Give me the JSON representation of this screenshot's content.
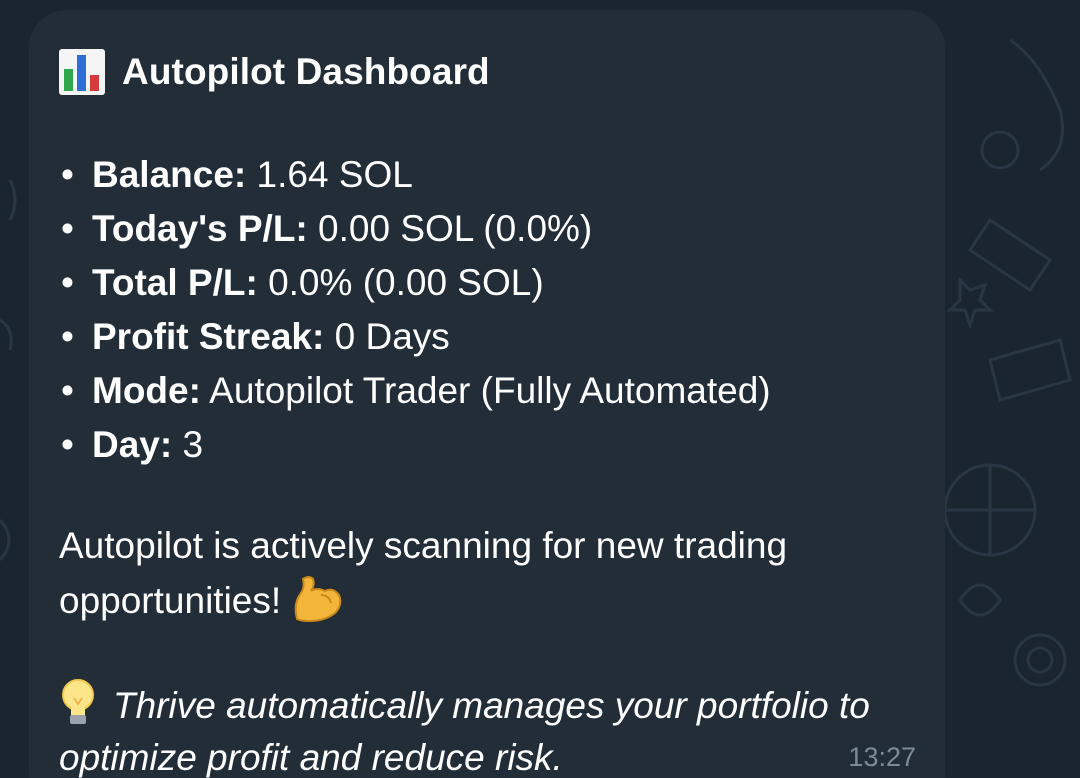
{
  "message": {
    "title": "Autopilot Dashboard",
    "title_icon": "bar-chart-icon",
    "stats": [
      {
        "label": "Balance:",
        "value": " 1.64 SOL"
      },
      {
        "label": "Today's P/L:",
        "value": " 0.00 SOL (0.0%)"
      },
      {
        "label": "Total P/L:",
        "value": " 0.0% (0.00 SOL)"
      },
      {
        "label": "Profit Streak:",
        "value": " 0 Days"
      },
      {
        "label": "Mode:",
        "value": " Autopilot Trader (Fully Automated)"
      },
      {
        "label": "Day:",
        "value": " 3"
      }
    ],
    "bullet": "•",
    "status_text": "Autopilot is actively scanning for new trading opportunities!",
    "status_emoji": "flexed-biceps-icon",
    "tip_icon": "light-bulb-icon",
    "tip_text": "Thrive automatically manages your portfolio to optimize profit and reduce risk.",
    "timestamp": "13:27"
  },
  "colors": {
    "background": "#1b2530",
    "bubble": "#222d38",
    "text": "#ffffff",
    "timestamp": "#7d8b99"
  }
}
